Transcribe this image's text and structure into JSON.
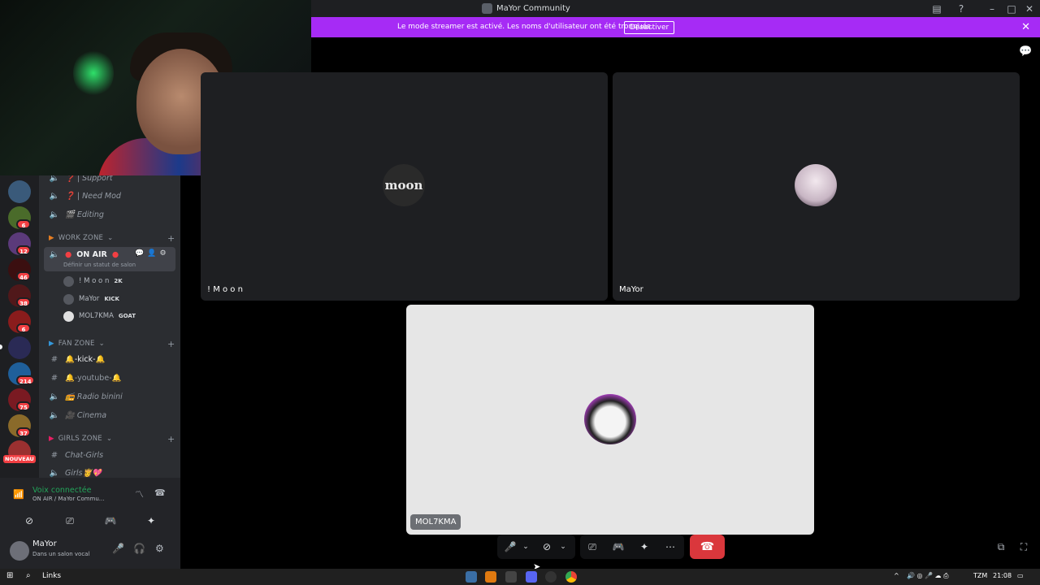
{
  "window": {
    "title": "MaYor Community"
  },
  "banner": {
    "message": "Le mode streamer est activé. Les noms d'utilisateur ont été tronqués.",
    "button_label": "Désactiver"
  },
  "channels": {
    "items_top": [
      {
        "icon": "speaker-icon",
        "label": "❓ | Support"
      },
      {
        "icon": "speaker-icon",
        "label": "❓ | Need Mod"
      },
      {
        "icon": "speaker-icon",
        "label": "🎬 Editing"
      }
    ],
    "work_zone": {
      "category": "WORK ZONE",
      "active_channel": "ON AIR",
      "active_status": "Définir un statut de salon",
      "members": [
        {
          "name": "! M o o n",
          "tag": "2K"
        },
        {
          "name": "MaYor",
          "tag": "KICK"
        },
        {
          "name": "MOL7KMA",
          "tag": "GOAT"
        }
      ]
    },
    "fan_zone": {
      "category": "FAN ZONE",
      "items": [
        {
          "icon": "#",
          "label": "🔔-kick-🔔"
        },
        {
          "icon": "#",
          "label": "🔔-youtube-🔔"
        },
        {
          "icon": "speaker-icon",
          "label": "📻 Radio binini"
        },
        {
          "icon": "speaker-icon",
          "label": "🎥 Cinema"
        }
      ]
    },
    "girls_zone": {
      "category": "GIRLS ZONE",
      "items": [
        {
          "icon": "#",
          "label": "Chat-Girls"
        },
        {
          "icon": "speaker-icon",
          "label": "Girls👸💖"
        }
      ]
    }
  },
  "rail": {
    "badges": [
      "6",
      "12",
      "46",
      "38",
      "6",
      "214",
      "75",
      "37"
    ],
    "new_label": "NOUVEAU"
  },
  "voice_panel": {
    "status": "Voix connectée",
    "channel": "ON AIR / MaYor Commu..."
  },
  "user_panel": {
    "name": "MaYor",
    "status": "Dans un salon vocal"
  },
  "tiles": [
    {
      "name": "! M o o n"
    },
    {
      "name": "MaYor"
    },
    {
      "name": "MOL7KMA"
    }
  ],
  "tile_avatar_text": "moon",
  "taskbar": {
    "links": "Links",
    "lang": "TZM",
    "time": "21:08"
  },
  "colors": {
    "banner": "#a62bf5",
    "hangup": "#da373c",
    "connected": "#23a55a",
    "badge": "#f23f43"
  }
}
